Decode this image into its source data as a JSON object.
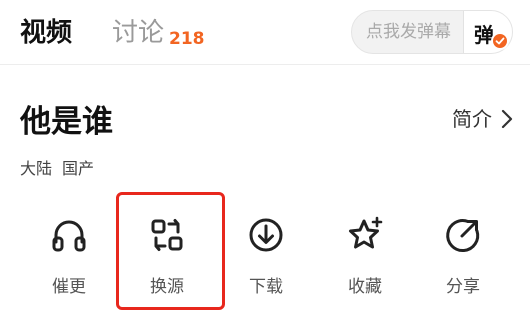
{
  "tabs": {
    "video_label": "视频",
    "discuss_label": "讨论",
    "discuss_count": "218"
  },
  "danmaku": {
    "placeholder": "点我发弹幕",
    "toggle_label": "弹"
  },
  "info": {
    "title": "他是谁",
    "intro_label": "简介",
    "meta": [
      "大陆",
      "国产"
    ]
  },
  "actions": [
    {
      "label": "催更",
      "icon": "headphones-icon"
    },
    {
      "label": "换源",
      "icon": "switch-source-icon"
    },
    {
      "label": "下载",
      "icon": "download-icon"
    },
    {
      "label": "收藏",
      "icon": "star-icon"
    },
    {
      "label": "分享",
      "icon": "share-icon"
    }
  ],
  "colors": {
    "accent": "#f26522",
    "highlight": "#e8271d"
  }
}
